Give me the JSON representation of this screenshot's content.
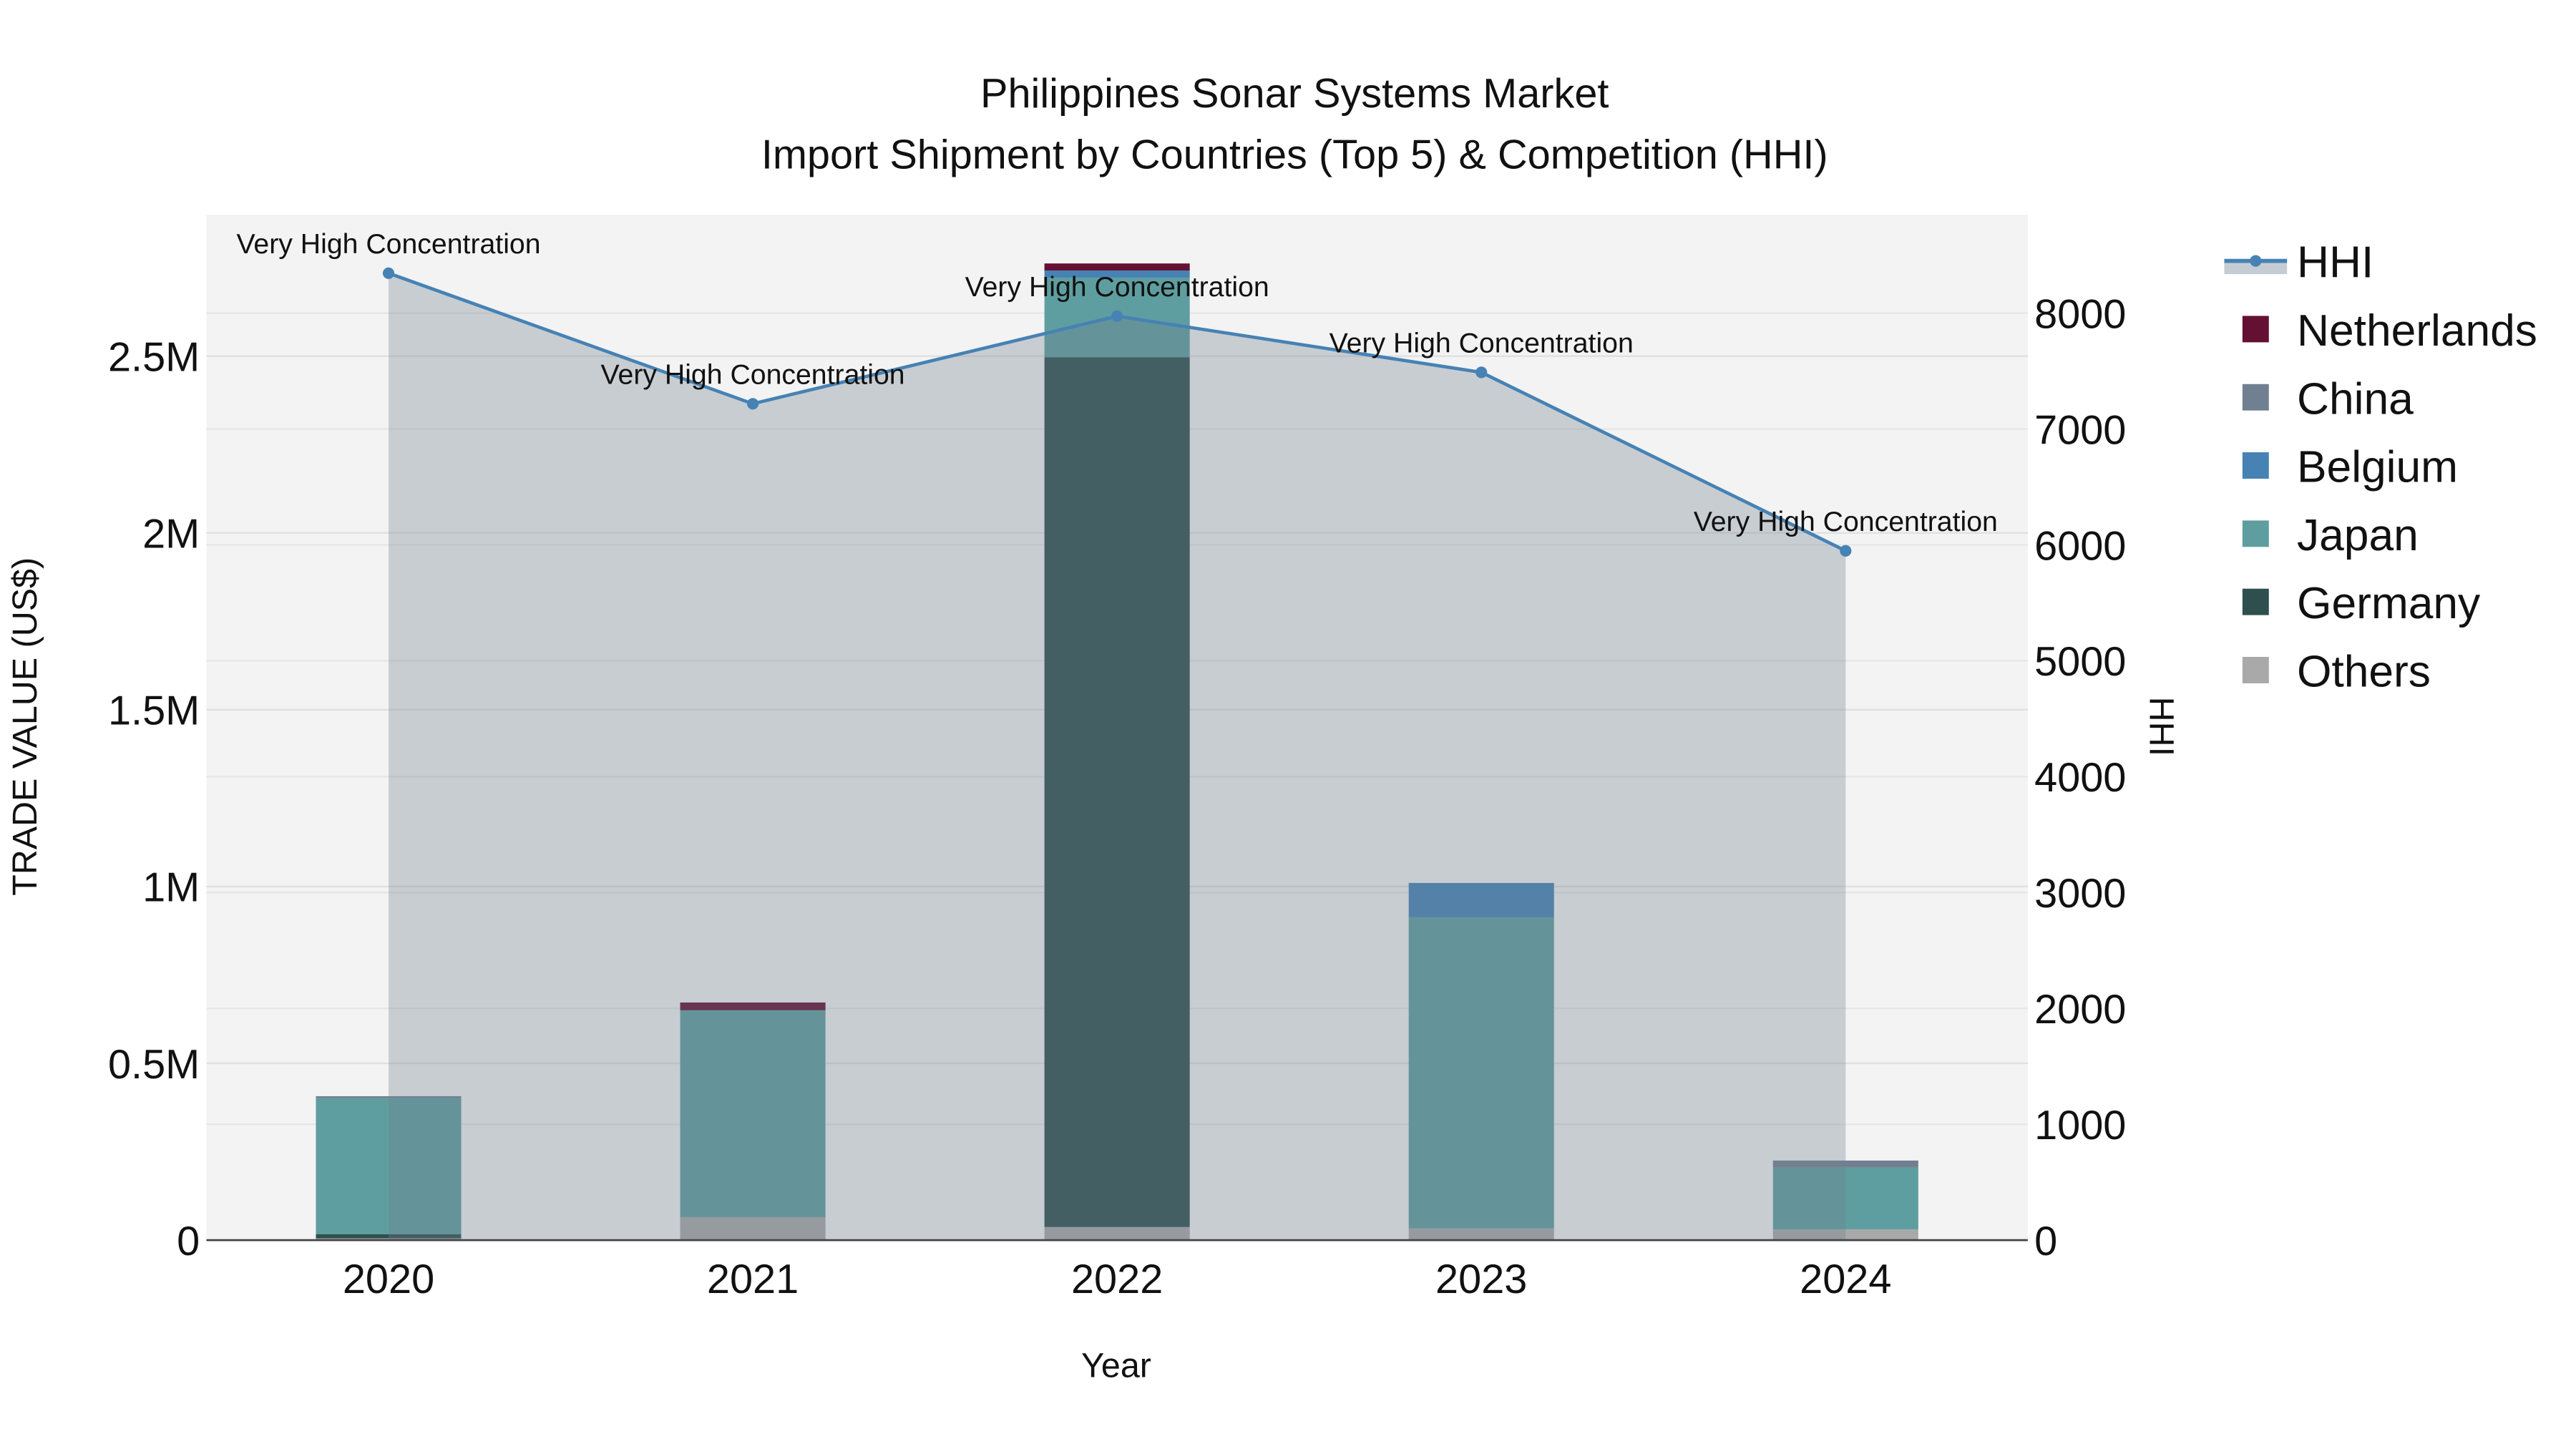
{
  "chart_data": {
    "type": "bar",
    "title_line1": "Philippines Sonar Systems Market",
    "title_line2": "Import Shipment by Countries (Top 5) & Competition (HHI)",
    "xlabel": "Year",
    "ylabel": "TRADE VALUE (US$)",
    "y2label": "HHI",
    "categories": [
      "2020",
      "2021",
      "2022",
      "2023",
      "2024"
    ],
    "ylim": [
      0,
      2900000
    ],
    "y2lim": [
      0,
      8850
    ],
    "yticks": [
      {
        "value": 0,
        "label": "0"
      },
      {
        "value": 500000,
        "label": "0.5M"
      },
      {
        "value": 1000000,
        "label": "1M"
      },
      {
        "value": 1500000,
        "label": "1.5M"
      },
      {
        "value": 2000000,
        "label": "2M"
      },
      {
        "value": 2500000,
        "label": "2.5M"
      }
    ],
    "y2ticks": [
      0,
      1000,
      2000,
      3000,
      4000,
      5000,
      6000,
      7000,
      8000
    ],
    "series": [
      {
        "name": "Others",
        "color": "#a9a9a9",
        "values": [
          5000,
          65000,
          37000,
          33000,
          30000
        ]
      },
      {
        "name": "Germany",
        "color": "#2f4f4f",
        "values": [
          12000,
          0,
          2460000,
          0,
          0
        ]
      },
      {
        "name": "Japan",
        "color": "#5f9ea0",
        "values": [
          385000,
          585000,
          225000,
          880000,
          175000
        ]
      },
      {
        "name": "Belgium",
        "color": "#4682b4",
        "values": [
          0,
          0,
          20000,
          97000,
          0
        ]
      },
      {
        "name": "China",
        "color": "#708090",
        "values": [
          5000,
          0,
          0,
          0,
          20000
        ]
      },
      {
        "name": "Netherlands",
        "color": "#641033",
        "values": [
          0,
          22000,
          20000,
          0,
          0
        ]
      }
    ],
    "hhi": {
      "name": "HHI",
      "color": "#4682b4",
      "values": [
        8345,
        7218,
        7974,
        7489,
        5949
      ],
      "annotations": [
        "Very High Concentration",
        "Very High Concentration",
        "Very High Concentration",
        "Very High Concentration",
        "Very High Concentration"
      ]
    },
    "legend": [
      "HHI",
      "Netherlands",
      "China",
      "Belgium",
      "Japan",
      "Germany",
      "Others"
    ],
    "legend_placement": "right",
    "grid": true
  }
}
